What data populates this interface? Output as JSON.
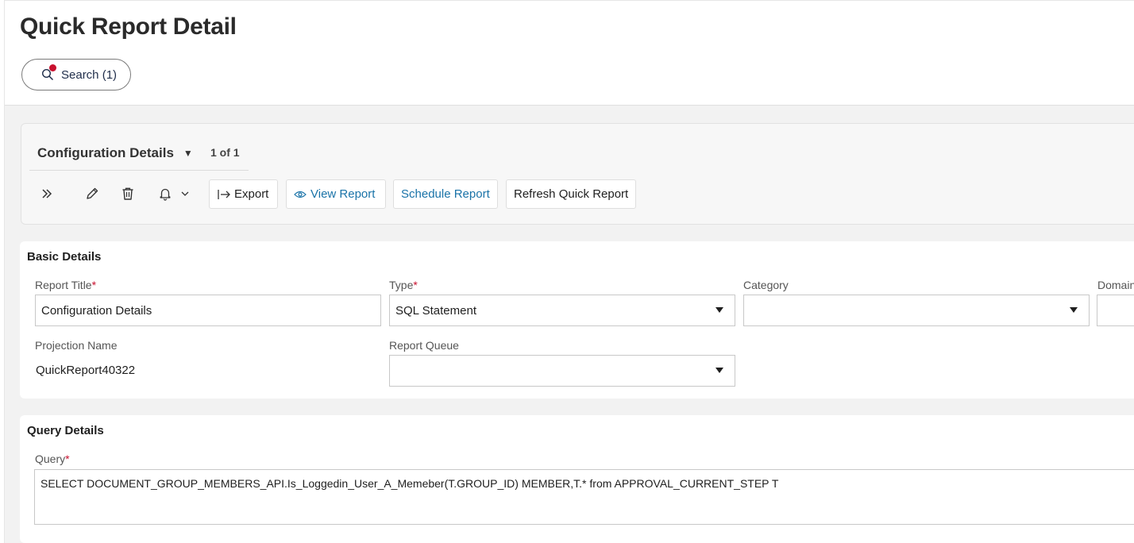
{
  "page": {
    "title": "Quick Report Detail"
  },
  "search": {
    "label": "Search (1)"
  },
  "config": {
    "title": "Configuration Details",
    "pager": "1 of 1"
  },
  "toolbar": {
    "export_label": "Export",
    "view_report_label": "View Report",
    "schedule_report_label": "Schedule Report",
    "refresh_label": "Refresh Quick Report"
  },
  "basic": {
    "title": "Basic Details",
    "report_title": {
      "label": "Report Title",
      "value": "Configuration Details"
    },
    "type": {
      "label": "Type",
      "value": "SQL Statement"
    },
    "category": {
      "label": "Category",
      "value": ""
    },
    "domain": {
      "label": "Domain"
    },
    "projection": {
      "label": "Projection Name",
      "value": "QuickReport40322"
    },
    "report_queue": {
      "label": "Report Queue",
      "value": ""
    }
  },
  "query": {
    "title": "Query Details",
    "label": "Query",
    "value": "SELECT DOCUMENT_GROUP_MEMBERS_API.Is_Loggedin_User_A_Memeber(T.GROUP_ID) MEMBER,T.* from APPROVAL_CURRENT_STEP T"
  },
  "colors": {
    "accent": "#1a73a8",
    "required": "#c8102e",
    "text": "#1f1f1f"
  }
}
